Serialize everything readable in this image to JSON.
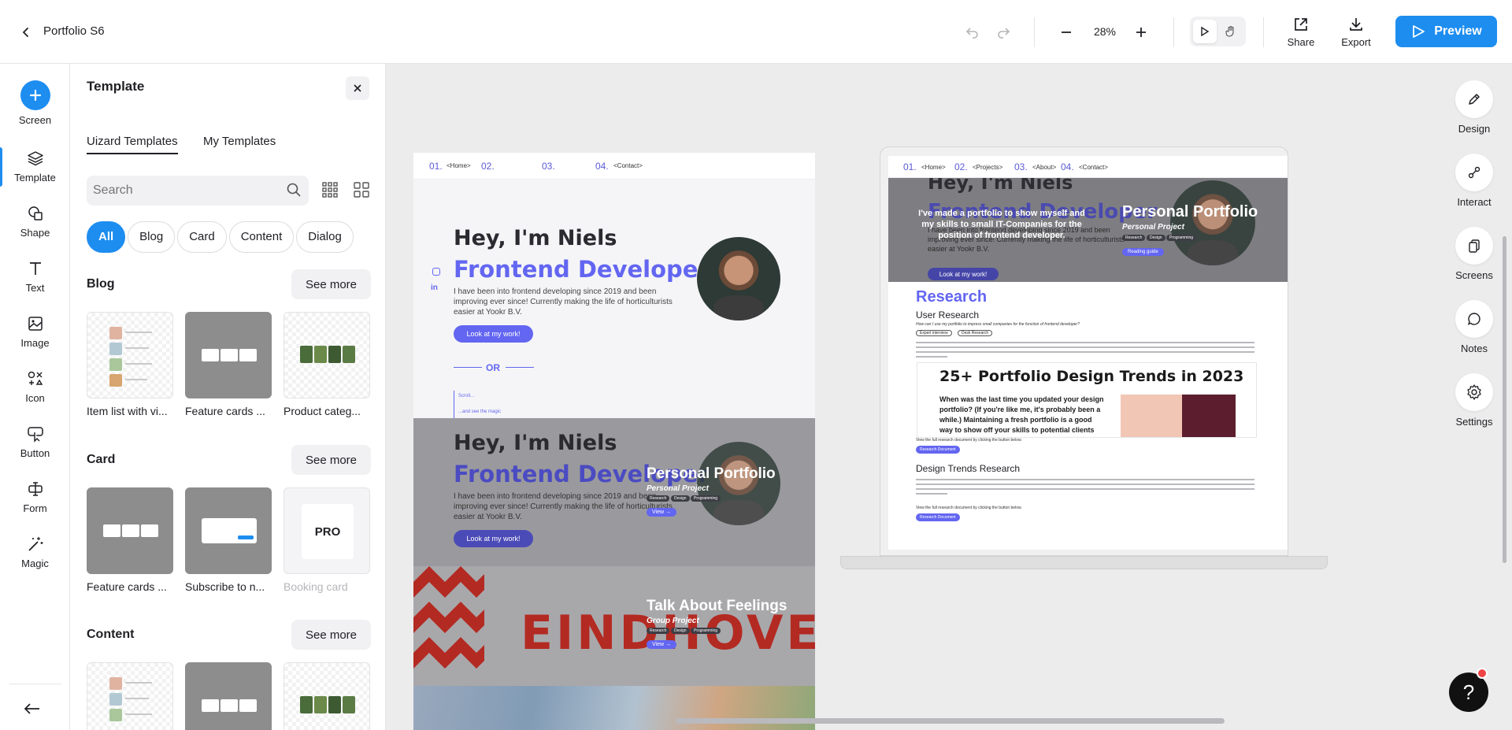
{
  "header": {
    "project_title": "Portfolio S6",
    "zoom": "28%",
    "share_label": "Share",
    "export_label": "Export",
    "preview_label": "Preview"
  },
  "rail": {
    "items": [
      {
        "label": "Screen",
        "icon": "plus-icon"
      },
      {
        "label": "Template",
        "icon": "layers-icon"
      },
      {
        "label": "Shape",
        "icon": "shape-icon"
      },
      {
        "label": "Text",
        "icon": "text-icon"
      },
      {
        "label": "Image",
        "icon": "image-icon"
      },
      {
        "label": "Icon",
        "icon": "icons-icon"
      },
      {
        "label": "Button",
        "icon": "cursor-icon"
      },
      {
        "label": "Form",
        "icon": "input-icon"
      },
      {
        "label": "Magic",
        "icon": "magic-wand-icon"
      }
    ]
  },
  "panel": {
    "title": "Template",
    "tabs": [
      "Uizard Templates",
      "My Templates"
    ],
    "search_placeholder": "Search",
    "chips": [
      "All",
      "Blog",
      "Card",
      "Content",
      "Dialog"
    ],
    "see_more": "See more",
    "sections": [
      {
        "title": "Blog",
        "tiles": [
          "Item list with vi...",
          "Feature cards ...",
          "Product categ..."
        ]
      },
      {
        "title": "Card",
        "tiles": [
          "Feature cards ...",
          "Subscribe to n...",
          "Booking card"
        ]
      },
      {
        "title": "Content",
        "tiles": [
          "",
          "",
          ""
        ]
      }
    ],
    "pro_badge": "PRO"
  },
  "canvas": {
    "screen1": {
      "nav": [
        "01.",
        "<Home>",
        "02.",
        "03.",
        "04.",
        "<Contact>"
      ],
      "greeting": "Hey, I'm Niels",
      "role": "Frontend Developer",
      "bio": "I have been into frontend developing since 2019 and been improving ever since! Currently making the life of horticulturists easier at Yookr B.V.",
      "cta": "Look at my work!",
      "or": "OR",
      "scroll_hint": "Scroll...",
      "scroll_hint2": "...and see the magic",
      "card1_title": "Personal Portfolio",
      "card1_sub": "Personal Project",
      "tags": [
        "Research",
        "Design",
        "Programming"
      ],
      "view": "View →",
      "card2_title": "Talk About Feelings",
      "card2_sub": "Group Project",
      "city_word": "EINDHOVEN"
    },
    "screen2": {
      "nav": [
        "01.",
        "<Home>",
        "02.",
        "<Projects>",
        "03.",
        "<About>",
        "04.",
        "<Contact>"
      ],
      "intro": "I've made a portfolio to show myself and my skills to small IT-Companies for the position of frontend developer.",
      "card_title": "Personal Portfolio",
      "card_sub": "Personal Project",
      "reading_guide": "Reading guide",
      "research": "Research",
      "user_research": "User Research",
      "question": "How can I use my portfolio to impress small companies for the function of frontend developer?",
      "chips": [
        "Expert interview",
        "Desk Research"
      ],
      "article_title": "25+ Portfolio Design Trends in 2023",
      "article_body": "When was the last time you updated your design portfolio? (If you're like me, it's probably been a while.) Maintaining a fresh portfolio is a good way to show off your skills to potential clients and can be helpful when looking back on work for renewal",
      "view_doc": "View the full research document by clicking the button below.",
      "doc_btn": "Research Document",
      "design_trends": "Design Trends Research"
    }
  },
  "right_rail": {
    "items": [
      {
        "label": "Design",
        "icon": "pen-icon"
      },
      {
        "label": "Interact",
        "icon": "connect-icon"
      },
      {
        "label": "Screens",
        "icon": "screens-icon"
      },
      {
        "label": "Notes",
        "icon": "comment-icon"
      },
      {
        "label": "Settings",
        "icon": "gear-icon"
      }
    ]
  },
  "help_label": "?",
  "colors": {
    "accent": "#1d8df0",
    "brand_purple": "#6366f1"
  }
}
